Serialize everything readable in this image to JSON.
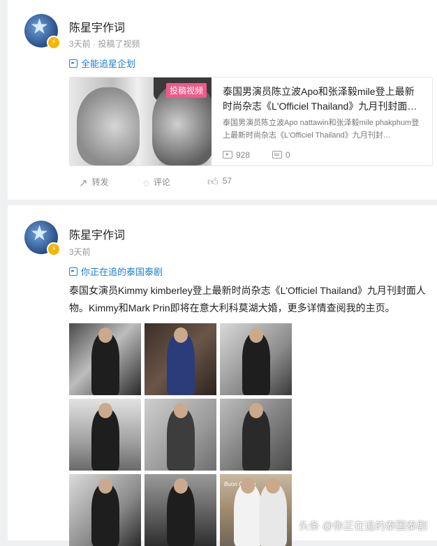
{
  "post1": {
    "author": "陈星宇作词",
    "meta": "3天前 · 投稿了视频",
    "topic": "全能追星企划",
    "media": {
      "tag": "投稿视频",
      "title": "泰国男演员陈立波Apo和张泽毅mile登上最新时尚杂志《L'Officiel Thailand》九月刊封面…",
      "description": "泰国男演员陈立波Apo nattawin和张泽毅mile phakphum登上最新时尚杂志《L'Officiel Thailand》九月刊封…",
      "plays": "928",
      "comments": "0"
    },
    "actions": {
      "forward": "转发",
      "comment": "评论",
      "likes": "57"
    }
  },
  "post2": {
    "author": "陈星宇作词",
    "meta": "3天前",
    "topic": "你正在追的泰国泰剧",
    "text": "泰国女演员Kimmy kimberley登上最新时尚杂志《L'Officiel Thailand》九月刊封面人物。Kimmy和Mark Prin即将在意大利科莫湖大婚，更多详情查阅我的主页。",
    "photo_overlay_text": "Buon Giorno"
  },
  "watermark": "头条 @你正在追的泰国泰剧",
  "icons": {
    "verified": "lightning-badge-icon",
    "topic": "topic-tag-icon",
    "forward": "share-icon",
    "comment": "comment-icon",
    "like": "thumbs-up-icon",
    "plays": "play-icon",
    "comments": "comment-count-icon"
  },
  "colors": {
    "link": "#1e7fd6",
    "tag": "#ef5a8a",
    "badge": "#f7b500",
    "page_bg": "#eef0f2"
  }
}
